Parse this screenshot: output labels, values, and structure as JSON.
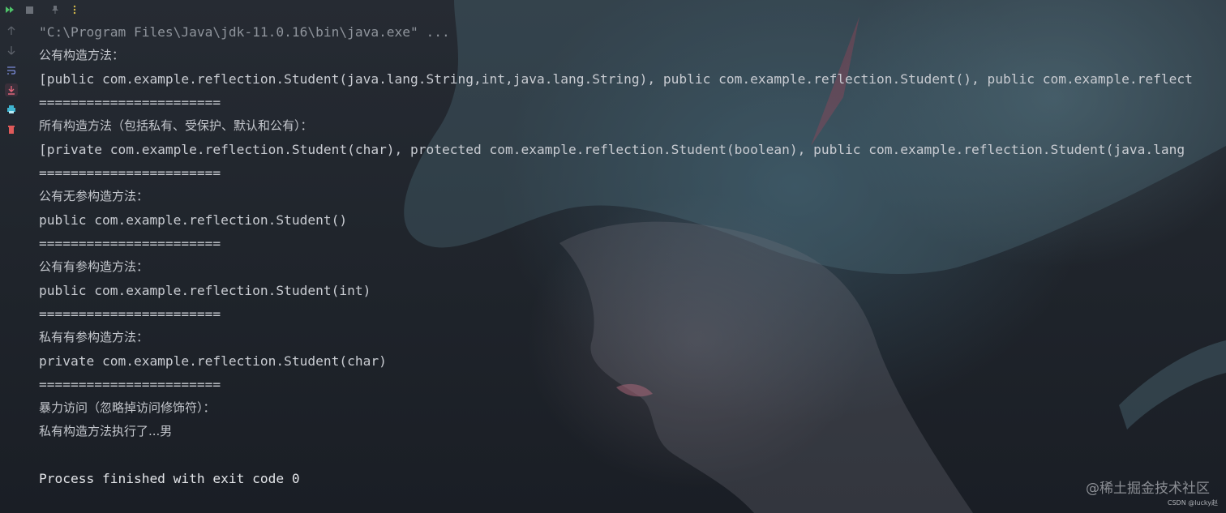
{
  "toolbar": {
    "icons": [
      "rerun-icon",
      "stop-icon",
      "pin-icon",
      "more-options-icon"
    ],
    "accent": "#4fc36a"
  },
  "gutter": {
    "icons": [
      "scroll-up-icon",
      "scroll-down-icon",
      "soft-wrap-icon",
      "scroll-to-end-icon",
      "print-icon",
      "clear-all-icon"
    ],
    "colors": {
      "scroll_to_end": "#e0657a",
      "print": "#3fb4d0",
      "trash": "#e05a5a"
    }
  },
  "console": {
    "lines": [
      "\"C:\\Program Files\\Java\\jdk-11.0.16\\bin\\java.exe\" ...",
      "公有构造方法：",
      "[public com.example.reflection.Student(java.lang.String,int,java.lang.String), public com.example.reflection.Student(), public com.example.reflect",
      "=======================",
      "所有构造方法（包括私有、受保护、默认和公有）：",
      "[private com.example.reflection.Student(char), protected com.example.reflection.Student(boolean), public com.example.reflection.Student(java.lang",
      "=======================",
      "公有无参构造方法：",
      "public com.example.reflection.Student()",
      "=======================",
      "公有有参构造方法：",
      "public com.example.reflection.Student(int)",
      "=======================",
      "私有有参构造方法：",
      "private com.example.reflection.Student(char)",
      "=======================",
      "暴力访问（忽略掉访问修饰符）：",
      "私有构造方法执行了...男",
      "",
      "Process finished with exit code 0"
    ]
  },
  "watermark": {
    "text": "@稀土掘金技术社区",
    "csdn": "CSDN @lucky赵"
  }
}
